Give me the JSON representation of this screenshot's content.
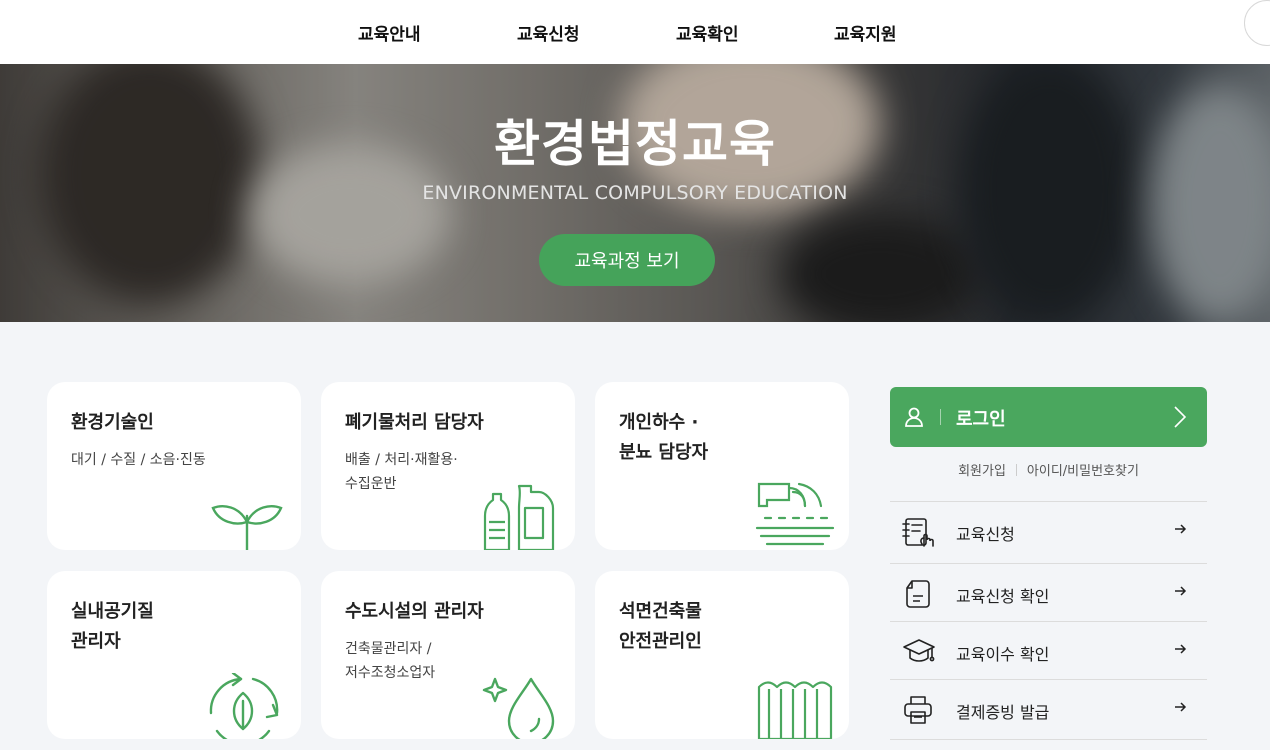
{
  "nav": {
    "items": [
      "교육안내",
      "교육신청",
      "교육확인",
      "교육지원"
    ]
  },
  "hero": {
    "title": "환경법정교육",
    "subtitle": "ENVIRONMENTAL COMPULSORY EDUCATION",
    "button": "교육과정 보기"
  },
  "cards": [
    {
      "title": "환경기술인",
      "desc": "대기 / 수질 / 소음·진동",
      "icon": "sprout-icon"
    },
    {
      "title": "폐기물처리 담당자",
      "desc": "배출 / 처리·재활용·\n수집운반",
      "icon": "bottles-icon"
    },
    {
      "title": "개인하수 ·\n분뇨 담당자",
      "desc": "",
      "icon": "sewage-pipe-icon"
    },
    {
      "title": "실내공기질\n관리자",
      "desc": "",
      "icon": "recycle-leaf-icon"
    },
    {
      "title": "수도시설의 관리자",
      "desc": "건축물관리자 /\n저수조청소업자",
      "icon": "water-drop-icon"
    },
    {
      "title": "석면건축물\n안전관리인",
      "desc": "",
      "icon": "asbestos-panel-icon"
    }
  ],
  "login": {
    "label": "로그인",
    "signup": "회원가입",
    "find": "아이디/비밀번호찾기"
  },
  "quick_links": [
    {
      "label": "교육신청",
      "icon": "apply-icon"
    },
    {
      "label": "교육신청 확인",
      "icon": "document-icon"
    },
    {
      "label": "교육이수 확인",
      "icon": "graduation-cap-icon"
    },
    {
      "label": "결제증빙 발급",
      "icon": "printer-icon"
    }
  ],
  "colors": {
    "accent": "#4aa75e",
    "icon_green": "#4aa75e"
  }
}
